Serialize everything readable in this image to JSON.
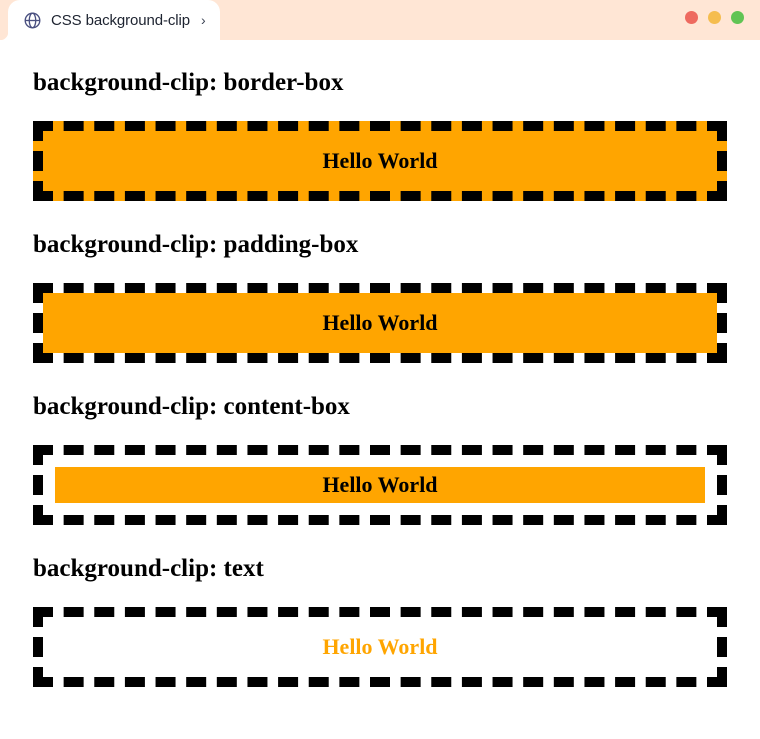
{
  "window": {
    "tab": {
      "title": "CSS background-clip",
      "icon": "globe-icon",
      "chevron": "›"
    },
    "controls": {
      "close_color": "#ee6a5f",
      "minimize_color": "#f5bd4f",
      "maximize_color": "#61c454"
    },
    "chrome_background": "#ffe6d5",
    "page_background": "#ffffff"
  },
  "theme": {
    "accent_orange": "#ffa500",
    "border_black": "#000000",
    "text_black": "#000000"
  },
  "sections": [
    {
      "heading": "background-clip: border-box",
      "box_text": "Hello World",
      "clip": "border-box"
    },
    {
      "heading": "background-clip: padding-box",
      "box_text": "Hello World",
      "clip": "padding-box"
    },
    {
      "heading": "background-clip: content-box",
      "box_text": "Hello World",
      "clip": "content-box"
    },
    {
      "heading": "background-clip: text",
      "box_text": "Hello World",
      "clip": "text"
    }
  ]
}
